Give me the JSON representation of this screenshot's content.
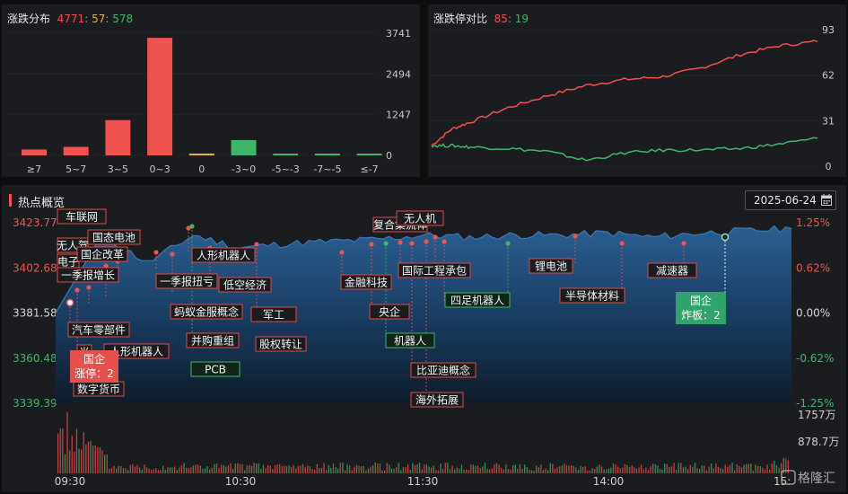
{
  "dist": {
    "title": "涨跌分布",
    "up": "4771",
    "flat": "57",
    "down": "578",
    "y_ticks": [
      "3741",
      "2494",
      "1247",
      "0"
    ],
    "colors": {
      "up": "#f0524f",
      "flat": "#e8b23a",
      "down": "#3fb56a"
    }
  },
  "limit": {
    "title": "涨跌停对比",
    "up": "85",
    "down": "19",
    "y_ticks": [
      "93",
      "62",
      "31",
      "0"
    ]
  },
  "hot": {
    "title": "热点概览",
    "date": "2025-06-24",
    "calendar_icon": "calendar-icon",
    "left_axis": [
      "3423.77",
      "3402.68",
      "3381.58",
      "3360.48",
      "3339.39"
    ],
    "right_axis": [
      "1.25%",
      "0.62%",
      "0.00%",
      "-0.62%",
      "-1.25%"
    ],
    "volume_axis": [
      "1757万",
      "878.7万"
    ],
    "time_axis": [
      "09:30",
      "10:30",
      "11:30",
      "14:00",
      "15:"
    ],
    "watermark": "格隆汇",
    "tags": [
      "车联网",
      "无人驾",
      "国态电池",
      "电子",
      "国企改革",
      "一季报增长",
      "一季报扭亏",
      "人形机器人",
      "低空经济",
      "蚂蚁金服概念",
      "军工",
      "并购重组",
      "股权转让",
      "PCB",
      "汽车零部件",
      "半",
      "人形机器人",
      "国企",
      "涨停：2",
      "数字货币",
      "复合集流体",
      "无人机",
      "金融科技",
      "央企",
      "机器人",
      "国际工程承包",
      "四足机器人",
      "比亚迪概念",
      "海外拓展",
      "锂电池",
      "半导体材料",
      "减速器",
      "国企",
      "炸板：2"
    ]
  },
  "chart_data": [
    {
      "type": "bar",
      "title": "涨跌分布",
      "categories": [
        "≥7",
        "5~7",
        "3~5",
        "0~3",
        "0",
        "-3~0",
        "-5~-3",
        "-7~-5",
        "≤-7"
      ],
      "values": [
        180,
        260,
        1080,
        3600,
        57,
        470,
        55,
        25,
        45
      ],
      "ylim": [
        0,
        3741
      ]
    },
    {
      "type": "line",
      "title": "涨跌停对比",
      "ylim": [
        0,
        93
      ],
      "x": [
        0,
        5,
        10,
        20,
        30,
        40,
        50,
        60,
        70,
        80,
        90,
        100
      ],
      "series": [
        {
          "values": [
            14,
            25,
            30,
            40,
            48,
            55,
            59,
            61,
            67,
            76,
            82,
            85
          ]
        },
        {
          "values": [
            14,
            14,
            13,
            12,
            10,
            4,
            9,
            11,
            11,
            12,
            15,
            19
          ]
        }
      ]
    },
    {
      "type": "area",
      "title": "热点概览",
      "x": [
        "09:30",
        "09:45",
        "10:00",
        "10:15",
        "10:30",
        "10:45",
        "11:00",
        "11:15",
        "11:30",
        "13:15",
        "13:30",
        "13:45",
        "14:00",
        "14:15",
        "14:30",
        "14:45",
        "15:00"
      ],
      "y": [
        3381.6,
        3418.0,
        3405.0,
        3418.0,
        3412.0,
        3414.0,
        3415.0,
        3416.0,
        3418.0,
        3417.0,
        3418.0,
        3418.0,
        3419.0,
        3417.0,
        3419.0,
        3420.0,
        3421.0
      ],
      "ylim": [
        3339.39,
        3423.77
      ]
    }
  ]
}
